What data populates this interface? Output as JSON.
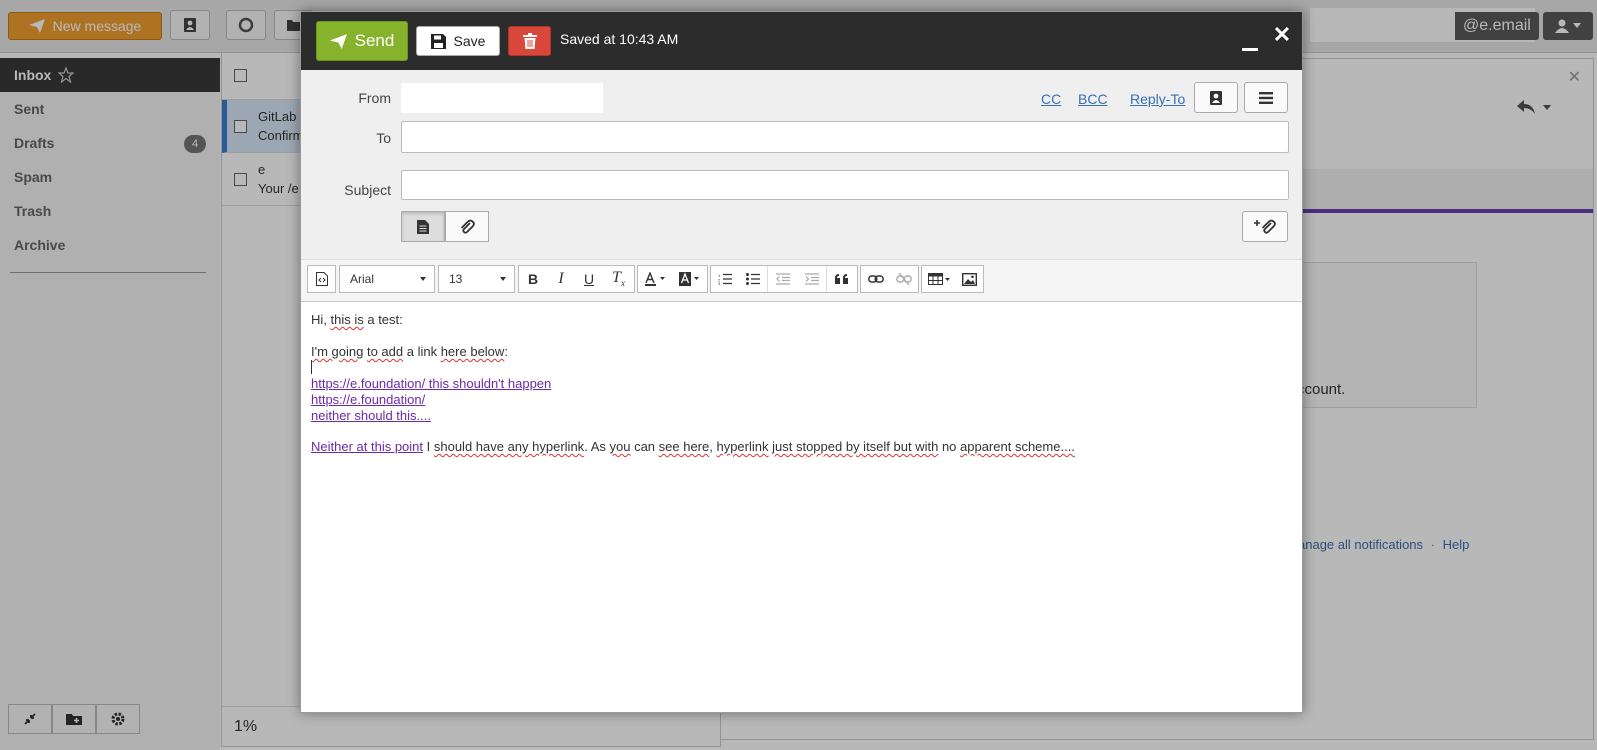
{
  "background": {
    "new_message_label": "New message",
    "email_suffix": "@e.email",
    "folders": [
      {
        "name": "Inbox",
        "active": true,
        "badge": ""
      },
      {
        "name": "Sent",
        "active": false,
        "badge": ""
      },
      {
        "name": "Drafts",
        "active": false,
        "badge": "4"
      },
      {
        "name": "Spam",
        "active": false,
        "badge": ""
      },
      {
        "name": "Trash",
        "active": false,
        "badge": ""
      },
      {
        "name": "Archive",
        "active": false,
        "badge": ""
      }
    ],
    "messages": [
      {
        "from": "GitLab",
        "subject": "Confirm",
        "selected": true
      },
      {
        "from": "e",
        "subject": "Your /e",
        "selected": false
      }
    ],
    "list_footer": "1%",
    "preview_text": "ccount.",
    "preview_footer_link1": "anage all notifications",
    "preview_footer_sep": "·",
    "preview_footer_link2": "Help"
  },
  "compose": {
    "send_label": "Send",
    "save_label": "Save",
    "status": "Saved at 10:43 AM",
    "from_label": "From",
    "to_label": "To",
    "subject_label": "Subject",
    "to_value": "",
    "subject_value": "",
    "cc_label": "CC",
    "bcc_label": "BCC",
    "replyto_label": "Reply-To",
    "font_family": "Arial",
    "font_size": "13",
    "body": {
      "line1_a": "Hi, ",
      "line1_b": "this is",
      "line1_c": " a test:",
      "line2_a": "I'm going",
      "line2_b": " ",
      "line2_c": "to add",
      "line2_d": " a link ",
      "line2_e": "here below",
      "line2_f": ":",
      "link1": "https://e.foundation/   this shouldn't happen",
      "link2": "https://e.foundation/",
      "link3": "neither should this....",
      "last_link": "Neither at this point",
      "last_a": " I ",
      "last_b": "should have any hyperlink",
      "last_c": ". As ",
      "last_d": "you",
      "last_e": " can ",
      "last_f": "see here",
      "last_g": ", ",
      "last_h": "hyperlink",
      "last_i": " ",
      "last_j": "just stopped by itself but with",
      "last_k": " no ",
      "last_l": "apparent scheme...."
    }
  }
}
